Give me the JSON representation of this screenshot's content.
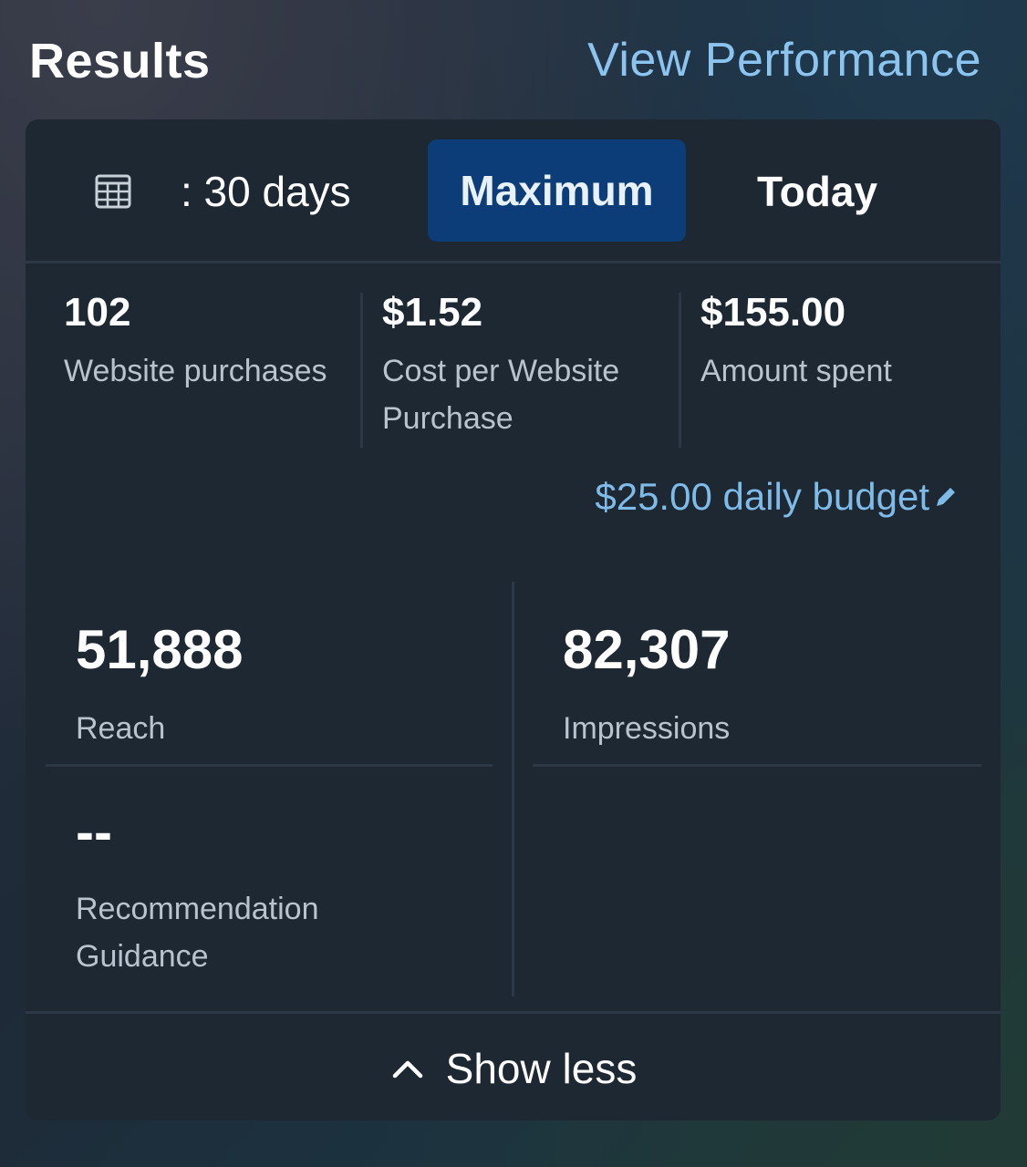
{
  "header": {
    "title": "Results",
    "view_performance": "View Performance"
  },
  "period": {
    "icon": "calendar-icon",
    "last_days": ": 30 days",
    "maximum": "Maximum",
    "today": "Today",
    "selected": "Maximum"
  },
  "summary": [
    {
      "value": "102",
      "label": "Website purchases"
    },
    {
      "value": "$1.52",
      "label": "Cost per Website Purchase"
    },
    {
      "value": "$155.00",
      "label": "Amount spent"
    }
  ],
  "budget": {
    "text": "$25.00 daily budget",
    "icon": "pencil-icon"
  },
  "details": {
    "reach": {
      "value": "51,888",
      "label": "Reach"
    },
    "impressions": {
      "value": "82,307",
      "label": "Impressions"
    },
    "recommendation": {
      "value": "--",
      "label": "Recommendation Guidance"
    }
  },
  "footer": {
    "show_less": "Show less",
    "icon": "chevron-up-icon"
  },
  "colors": {
    "card_bg": "#1d2833",
    "selected_period_bg": "#0c3d78",
    "link": "#8cc4f0",
    "budget_link": "#7fbbe8",
    "divider": "#2c3845"
  }
}
